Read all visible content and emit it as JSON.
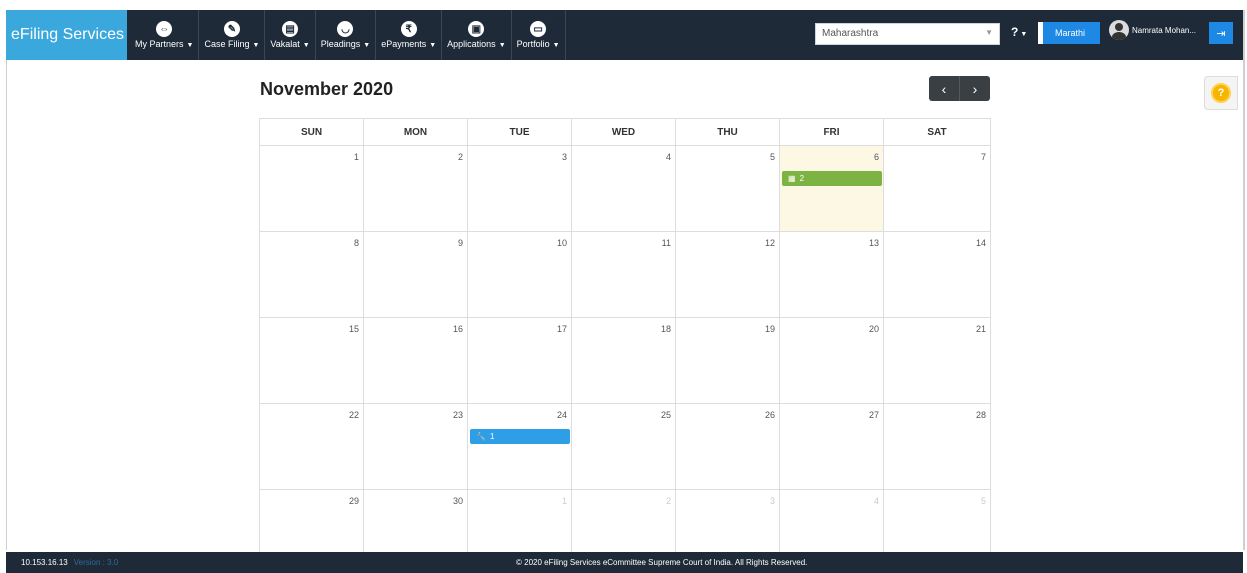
{
  "navbar": {
    "brand": "eFiling Services",
    "menus": [
      {
        "label": "My Partners",
        "icon": "handshake-icon"
      },
      {
        "label": "Case Filing",
        "icon": "pencil-icon"
      },
      {
        "label": "Vakalat",
        "icon": "document-icon"
      },
      {
        "label": "Pleadings",
        "icon": "cup-icon"
      },
      {
        "label": "ePayments",
        "icon": "rupee-icon"
      },
      {
        "label": "Applications",
        "icon": "file-icon"
      },
      {
        "label": "Portfolio",
        "icon": "briefcase-icon"
      }
    ],
    "state_select": "Maharashtra",
    "help": "?",
    "language_button": "Marathi",
    "user_name": "Namrata Mohan..."
  },
  "calendar": {
    "title": "November 2020",
    "prev": "‹",
    "next": "›",
    "weekdays": [
      "SUN",
      "MON",
      "TUE",
      "WED",
      "THU",
      "FRI",
      "SAT"
    ],
    "weeks": [
      [
        {
          "d": "1"
        },
        {
          "d": "2"
        },
        {
          "d": "3"
        },
        {
          "d": "4"
        },
        {
          "d": "5"
        },
        {
          "d": "6",
          "today": true,
          "event": {
            "label": "2",
            "color": "#7cb342",
            "icon": "calendar-icon"
          }
        },
        {
          "d": "7"
        }
      ],
      [
        {
          "d": "8"
        },
        {
          "d": "9"
        },
        {
          "d": "10"
        },
        {
          "d": "11"
        },
        {
          "d": "12"
        },
        {
          "d": "13"
        },
        {
          "d": "14"
        }
      ],
      [
        {
          "d": "15"
        },
        {
          "d": "16"
        },
        {
          "d": "17"
        },
        {
          "d": "18"
        },
        {
          "d": "19"
        },
        {
          "d": "20"
        },
        {
          "d": "21"
        }
      ],
      [
        {
          "d": "22"
        },
        {
          "d": "23"
        },
        {
          "d": "24",
          "event": {
            "label": "1",
            "color": "#2e9fe6",
            "icon": "wrench-icon"
          }
        },
        {
          "d": "25"
        },
        {
          "d": "26"
        },
        {
          "d": "27"
        },
        {
          "d": "28"
        }
      ],
      [
        {
          "d": "29"
        },
        {
          "d": "30"
        },
        {
          "d": "1",
          "other": true
        },
        {
          "d": "2",
          "other": true
        },
        {
          "d": "3",
          "other": true
        },
        {
          "d": "4",
          "other": true
        },
        {
          "d": "5",
          "other": true
        }
      ]
    ]
  },
  "help_float": "?",
  "footer": {
    "ip": "10.153.16.13",
    "version": "Version : 3.0",
    "copyright": "© 2020 eFiling Services eCommittee Supreme Court of India. All Rights Reserved."
  },
  "colors": {
    "navbar_bg": "#1e2a38",
    "brand_bg": "#3aa8dc",
    "accent_blue": "#1e88e5",
    "today_bg": "#fcf8e3"
  }
}
